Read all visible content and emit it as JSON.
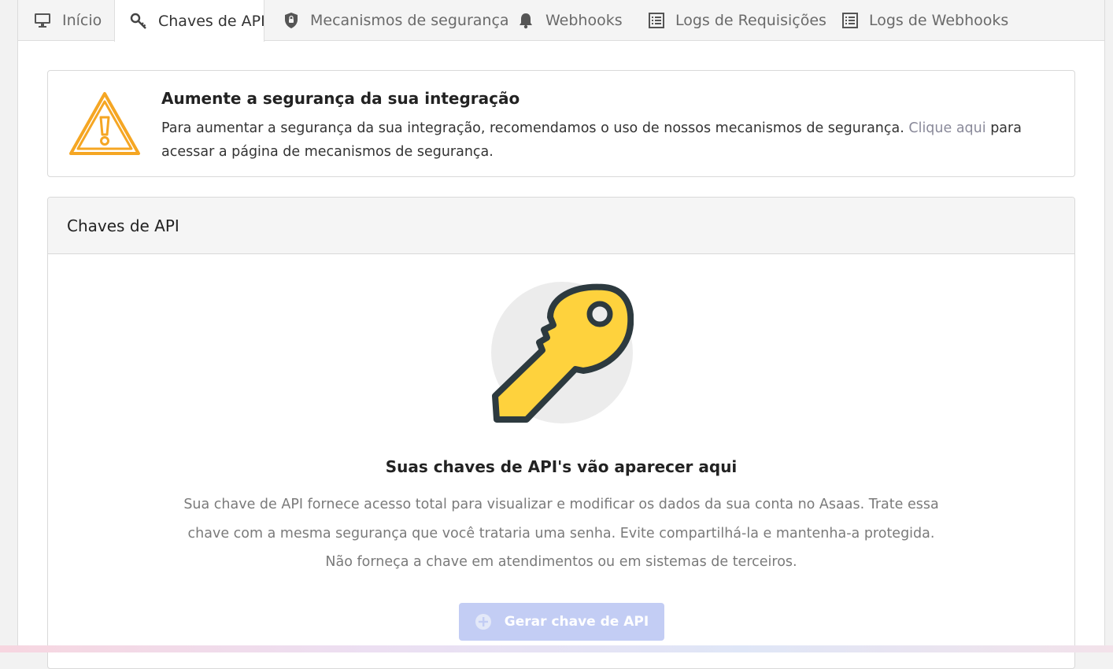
{
  "tabs": [
    {
      "label": "Início",
      "icon": "monitor-icon",
      "active": false
    },
    {
      "label": "Chaves de API",
      "icon": "key-icon",
      "active": true
    },
    {
      "label": "Mecanismos de segurança",
      "icon": "shield-icon",
      "active": false
    },
    {
      "label": "Webhooks",
      "icon": "bell-icon",
      "active": false
    },
    {
      "label": "Logs de Requisições",
      "icon": "list-icon",
      "active": false
    },
    {
      "label": "Logs de Webhooks",
      "icon": "list-icon",
      "active": false
    }
  ],
  "alert": {
    "title": "Aumente a segurança da sua integração",
    "text_before": "Para aumentar a segurança da sua integração, recomendamos o uso de nossos mecanismos de segurança. ",
    "link": "Clique aqui",
    "text_after": " para acessar a página de mecanismos de segurança.",
    "icon": "warning-icon",
    "icon_color": "#f5a623"
  },
  "card": {
    "title": "Chaves de API",
    "empty_title": "Suas chaves de API's vão aparecer aqui",
    "empty_text": "Sua chave de API fornece acesso total para visualizar e modificar os dados da sua conta no Asaas. Trate essa chave com a mesma segurança que você trataria uma senha. Evite compartilhá-la e mantenha-a protegida. Não forneça a chave em atendimentos ou em sistemas de terceiros.",
    "illustration": "key-illustration",
    "button_label": "Gerar chave de API",
    "button_icon": "plus-circle-icon",
    "button_color": "#c3cdf4"
  }
}
